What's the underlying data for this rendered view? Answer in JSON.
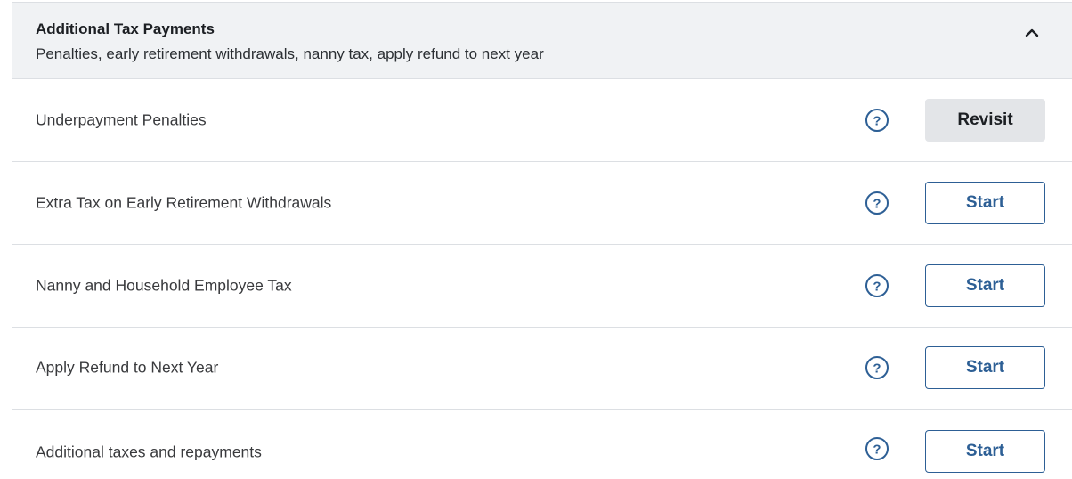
{
  "section": {
    "title": "Additional Tax Payments",
    "subtitle": "Penalties, early retirement withdrawals, nanny tax, apply refund to next year",
    "toggle_icon": "chevron-up-icon"
  },
  "rows": [
    {
      "label": "Underpayment Penalties",
      "button_label": "Revisit",
      "button_style": "revisit"
    },
    {
      "label": "Extra Tax on Early Retirement Withdrawals",
      "button_label": "Start",
      "button_style": "start"
    },
    {
      "label": "Nanny and Household Employee Tax",
      "button_label": "Start",
      "button_style": "start"
    },
    {
      "label": "Apply Refund to Next Year",
      "button_label": "Start",
      "button_style": "start"
    },
    {
      "label": "Additional taxes and repayments",
      "button_label": "Start",
      "button_style": "start"
    }
  ],
  "colors": {
    "accent": "#2d5f95",
    "header_bg": "#f0f2f4",
    "revisit_bg": "#e3e5e8",
    "divider": "#dcdfe3"
  }
}
